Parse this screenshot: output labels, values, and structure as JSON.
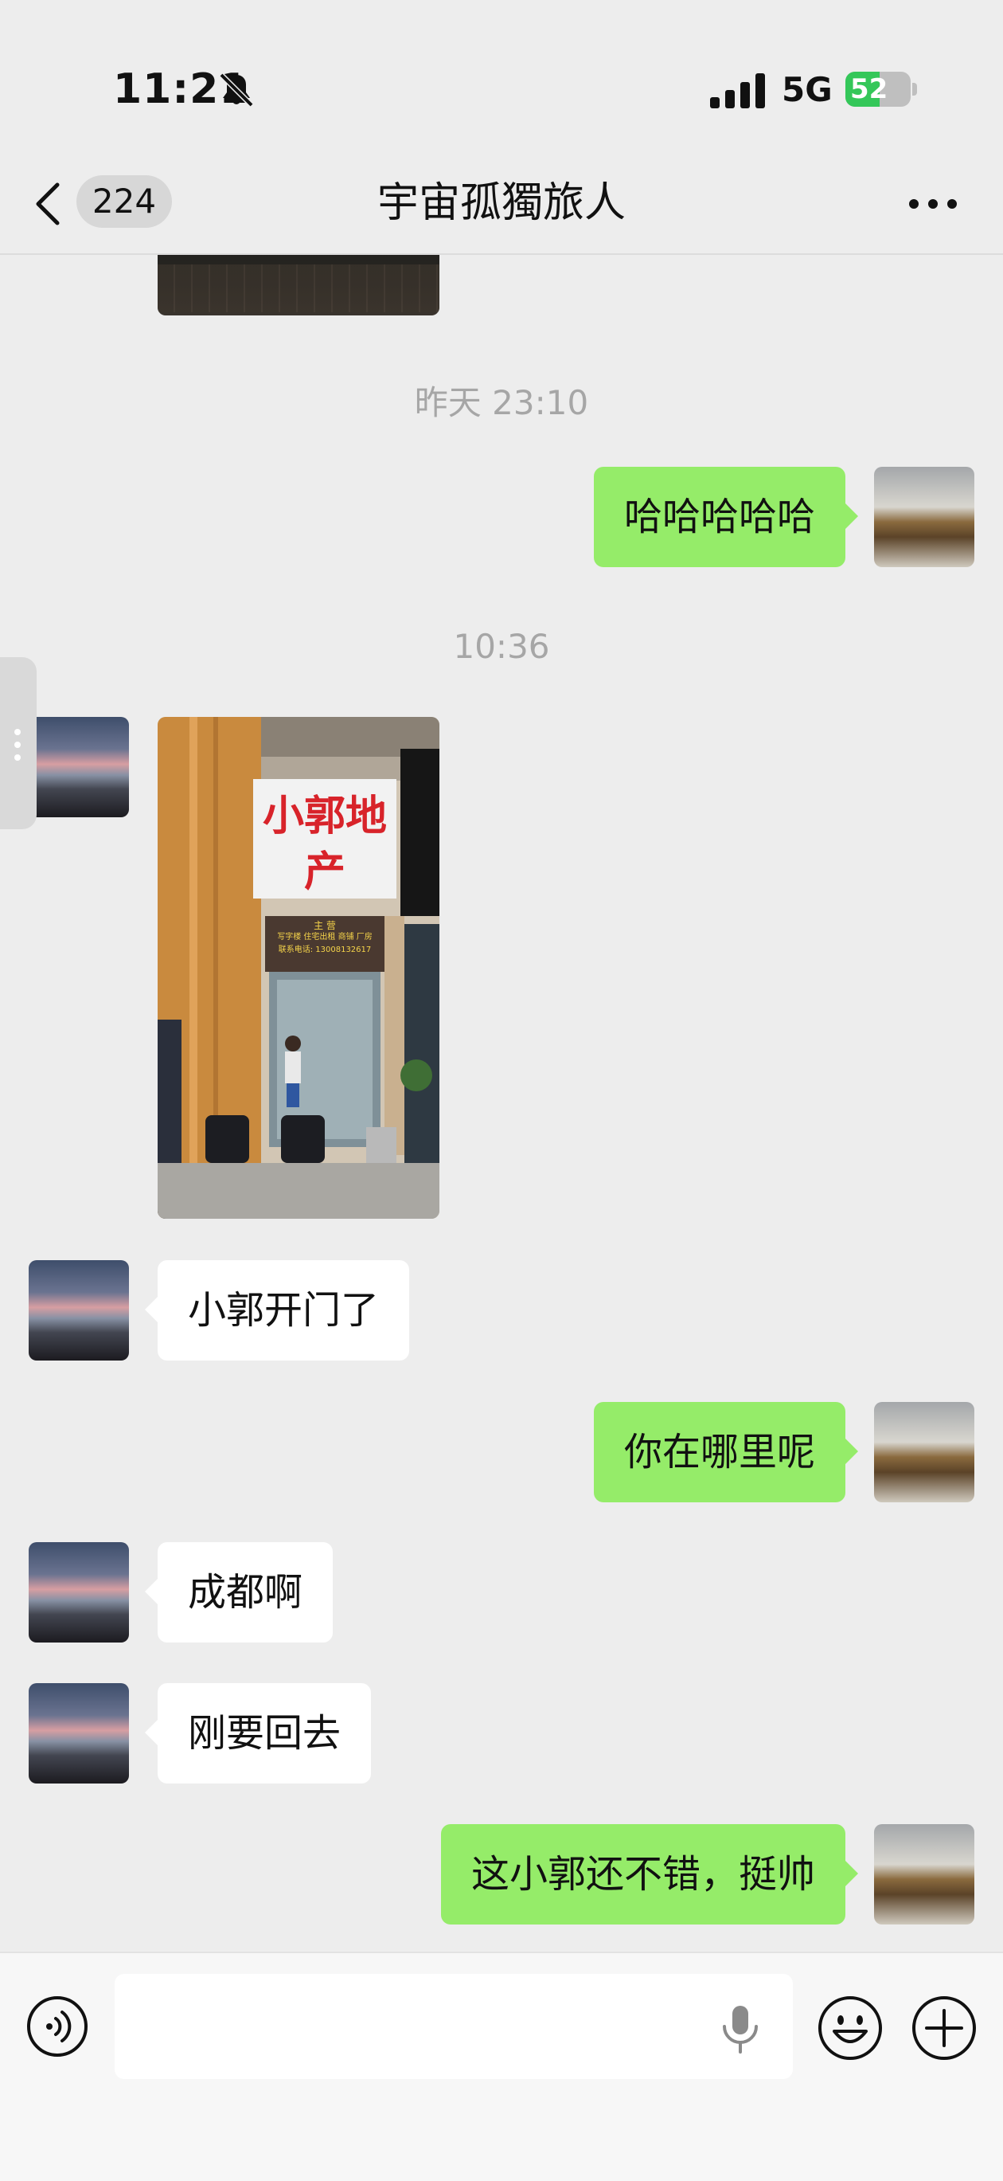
{
  "status_bar": {
    "time": "11:21",
    "network": "5G",
    "battery": "52",
    "battery_level_percent": 52
  },
  "header": {
    "back_count": "224",
    "title": "宇宙孤獨旅人"
  },
  "messages": {
    "ts1": "昨天 23:10",
    "m1": "哈哈哈哈哈",
    "ts2": "10:36",
    "photo_sign": "小郭地产",
    "photo_sign_small1": "主 营",
    "photo_sign_small2": "写字楼 住宅出租 商铺 厂房",
    "photo_sign_small3": "联系电话: 13008132617",
    "m2": "小郭开门了",
    "m3": "你在哪里呢",
    "m4": "成都啊",
    "m5": "刚要回去",
    "m6": "这小郭还不错，挺帅"
  },
  "icons": {
    "muted": "bell-slash-icon",
    "back": "chevron-left-icon",
    "more": "more-icon",
    "voice": "voice-icon",
    "mic": "microphone-icon",
    "emoji": "emoji-icon",
    "plus": "plus-icon"
  },
  "colors": {
    "outgoing_bubble": "#95ec69",
    "incoming_bubble": "#ffffff",
    "background": "#ededed"
  }
}
